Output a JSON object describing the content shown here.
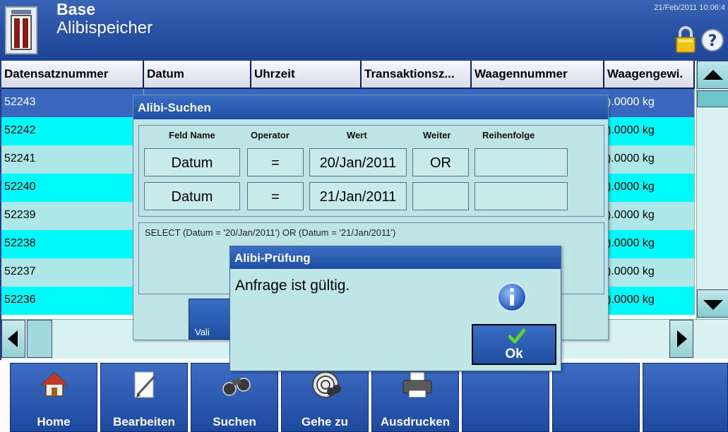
{
  "header": {
    "title": "Base",
    "subtitle": "Alibispeicher",
    "datetime": "21/Feb/2011 10:06:4"
  },
  "table": {
    "columns": [
      "Datensatznummer",
      "Datum",
      "Uhrzeit",
      "Transaktionsz...",
      "Waagennummer",
      "Waagengewi."
    ],
    "rows": [
      {
        "id": "52243",
        "weight": ").0000 kg"
      },
      {
        "id": "52242",
        "weight": ").0000 kg"
      },
      {
        "id": "52241",
        "weight": ").0000 kg"
      },
      {
        "id": "52240",
        "weight": ").0000 kg"
      },
      {
        "id": "52239",
        "weight": ").0000 kg"
      },
      {
        "id": "52238",
        "weight": ").0000 kg"
      },
      {
        "id": "52237",
        "weight": ").0000 kg"
      },
      {
        "id": "52236",
        "weight": ").0000 kg"
      }
    ]
  },
  "search_dialog": {
    "title": "Alibi-Suchen",
    "headers": [
      "Feld Name",
      "Operator",
      "Wert",
      "Weiter",
      "Reihenfolge"
    ],
    "rows": [
      {
        "field": "Datum",
        "operator": "=",
        "value": "20/Jan/2011",
        "next": "OR",
        "order": ""
      },
      {
        "field": "Datum",
        "operator": "=",
        "value": "21/Jan/2011",
        "next": "",
        "order": ""
      }
    ],
    "sql": "SELECT  (Datum = '20/Jan/2011')  OR  (Datum = '21/Jan/2011')",
    "validate_label": "Vali"
  },
  "check_dialog": {
    "title": "Alibi-Prüfung",
    "message": "Anfrage ist gültig.",
    "ok_label": "Ok"
  },
  "toolbar": {
    "buttons": [
      "Home",
      "Bearbeiten",
      "Suchen",
      "Gehe zu",
      "Ausdrucken"
    ]
  },
  "icons": [
    "app-icon",
    "lock-icon",
    "help-icon",
    "home-icon",
    "edit-icon",
    "binoculars-icon",
    "goto-icon",
    "printer-icon",
    "info-icon",
    "checkmark-icon"
  ],
  "colors": {
    "header_blue": "#2a53a6",
    "selected_row": "#3a68bf",
    "cyan_row": "#00fafa",
    "light_row": "#aee7e7",
    "dialog_bg": "#bfe4e6"
  }
}
